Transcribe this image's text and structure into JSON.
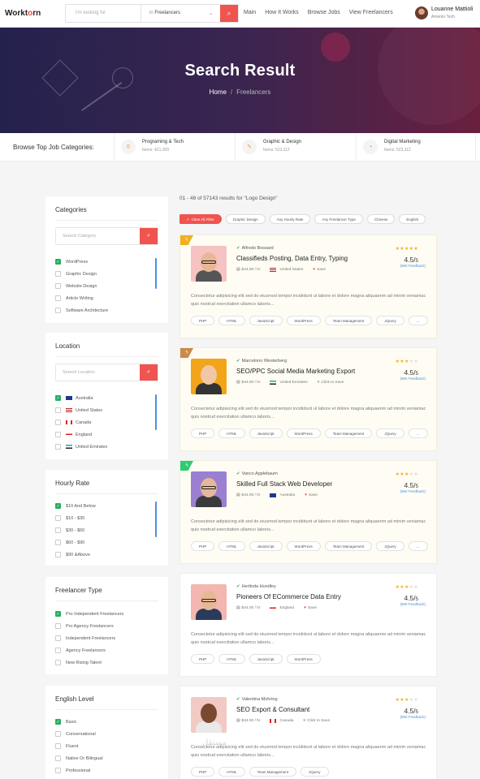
{
  "header": {
    "logo_pre": "Workt",
    "logo_o": "o",
    "logo_post": "rn",
    "search_placeholder": "I'm looking for",
    "in_label": "in",
    "in_value": "Freelancers",
    "nav": [
      "Main",
      "How It Works",
      "Browse Jobs",
      "View Freelancers"
    ],
    "user": {
      "name": "Louanne Mattioli",
      "company": "Amento Tech"
    }
  },
  "banner": {
    "title": "Search Result",
    "crumb_home": "Home",
    "crumb_sep": "/",
    "crumb_current": "Freelancers"
  },
  "catbar": {
    "label": "Browse Top Job Categories:",
    "items": [
      {
        "title": "Programing & Tech",
        "sub": "Items: 421,309"
      },
      {
        "title": "Graphic & Design",
        "sub": "Items: 523,112"
      },
      {
        "title": "Digital Marketing",
        "sub": "Items: 523,112"
      }
    ]
  },
  "sidebar": {
    "categories": {
      "title": "Categories",
      "placeholder": "Search Category",
      "options": [
        {
          "label": "WordPress",
          "checked": true
        },
        {
          "label": "Graphic Design",
          "checked": false
        },
        {
          "label": "Website Design",
          "checked": false
        },
        {
          "label": "Article Writing",
          "checked": false
        },
        {
          "label": "Software Architecture",
          "checked": false
        }
      ]
    },
    "location": {
      "title": "Location",
      "placeholder": "Search Location",
      "options": [
        {
          "label": "Australia",
          "checked": true
        },
        {
          "label": "United States",
          "checked": false
        },
        {
          "label": "Canada",
          "checked": false
        },
        {
          "label": "England",
          "checked": false
        },
        {
          "label": "United Emirates",
          "checked": false
        }
      ]
    },
    "hourly": {
      "title": "Hourly Rate",
      "options": [
        {
          "label": "$10 And Below",
          "checked": true
        },
        {
          "label": "$10 - $30",
          "checked": false
        },
        {
          "label": "$30 - $60",
          "checked": false
        },
        {
          "label": "$60 - $90",
          "checked": false
        },
        {
          "label": "$90 &Above",
          "checked": false
        }
      ]
    },
    "ftype": {
      "title": "Freelancer Type",
      "options": [
        {
          "label": "Pro Independent Freelancers",
          "checked": true
        },
        {
          "label": "Pro Agency Freelancers",
          "checked": false
        },
        {
          "label": "Independent Freelancers",
          "checked": false
        },
        {
          "label": "Agency Freelancers",
          "checked": false
        },
        {
          "label": "New Rising Talent",
          "checked": false
        }
      ]
    },
    "english": {
      "title": "English Level",
      "options": [
        {
          "label": "Basic",
          "checked": true
        },
        {
          "label": "Conversational",
          "checked": false
        },
        {
          "label": "Fluent",
          "checked": false
        },
        {
          "label": "Native Or Bilingual",
          "checked": false
        },
        {
          "label": "Professional",
          "checked": false
        }
      ]
    }
  },
  "results": {
    "summary": "01 - 48 of 57143 results for \"Logo Design\"",
    "clear": "Clear All Filter",
    "filters": [
      "Graphic Design",
      "Any Hourly Rate",
      "Any Freelancer Type",
      "Chinese",
      "English"
    ]
  },
  "cards": [
    {
      "name": "Alfredo Bossard",
      "title": "Classifieds Posting, Data Entry, Typing",
      "rate_txt": "$44.00 / hr",
      "country": "United States",
      "action": "Save",
      "rating": "4.5/",
      "rating_sub": "5",
      "feedback": "(860 Feedback)",
      "stars": 5,
      "ribbon": "#f2b01e",
      "desc": "Consectetur adipisicing elit sed do eiusmod tempor incididunt ut labore et dolore magna aliquaenm ad minim veniamac quis nostrud exercitation ullamco laboris...",
      "tags": [
        "PHP",
        "HTML",
        "JavaScript",
        "WordPress",
        "Team Management",
        "JQuery",
        "..."
      ]
    },
    {
      "name": "Marcelono Westerberg",
      "title": "SEO/PPC Social Media Marketing Export",
      "rate_txt": "$44.00 / hr",
      "country": "United Emirates",
      "action": "Click to Save",
      "rating": "4.5/",
      "rating_sub": "5",
      "feedback": "(860 Feedback)",
      "stars": 3,
      "ribbon": "#c98a4a",
      "desc": "Consectetur adipisicing elit sed do eiusmod tempor incididunt ut labore et dolore magna aliquaenm ad minim veniamac quis nostrud exercitation ullamco laboris...",
      "tags": [
        "PHP",
        "HTML",
        "JavaScript",
        "WordPress",
        "Team Management",
        "JQuery",
        "..."
      ]
    },
    {
      "name": "Vanco Applebaum",
      "title": "Skilled Full Stack Web Developer",
      "rate_txt": "$44.00 / hr",
      "country": "Australia",
      "action": "Save",
      "rating": "4.5/",
      "rating_sub": "5",
      "feedback": "(860 Feedback)",
      "stars": 3,
      "ribbon": "#2ecc71",
      "desc": "Consectetur adipisicing elit sed do eiusmod tempor incididunt ut labore et dolore magna aliquaenm ad minim veniamac quis nostrud exercitation ullamco laboris...",
      "tags": [
        "PHP",
        "HTML",
        "JavaScript",
        "WordPress",
        "Team Management",
        "JQuery",
        "..."
      ]
    },
    {
      "name": "Herlinda Hundley",
      "title": "Pioneers Of ECommerce Data Entry",
      "rate_txt": "$44.00 / hr",
      "country": "England",
      "action": "Save",
      "rating": "4.5/",
      "rating_sub": "5",
      "feedback": "(860 Feedback)",
      "stars": 3,
      "ribbon": "",
      "desc": "Consectetur adipisicing elit sed do eiusmod tempor incididunt ut labore et dolore magna aliquaenm ad minim veniamac quis nostrud exercitation ullamco laboris...",
      "tags": [
        "PHP",
        "HTML",
        "JavaScript",
        "WordPress"
      ]
    },
    {
      "name": "Valentina Mohring",
      "title": "SEO Export & Consultant",
      "rate_txt": "$44.00 / hr",
      "country": "Canada",
      "action": "Click to Save",
      "rating": "4.5/",
      "rating_sub": "5",
      "feedback": "(860 Feedback)",
      "stars": 3,
      "ribbon": "",
      "desc": "Consectetur adipisicing elit sed do eiusmod tempor incididunt ut labore et dolore magna aliquaenm ad minim veniamac quis nostrud exercitation ullamco laboris...",
      "tags": [
        "PHP",
        "HTML",
        "Team Management",
        "JQuery"
      ]
    }
  ],
  "colors": {
    "accent": "#f0544f",
    "check": "#27ae60",
    "link": "#4a90e2",
    "star": "#f2b01e"
  }
}
